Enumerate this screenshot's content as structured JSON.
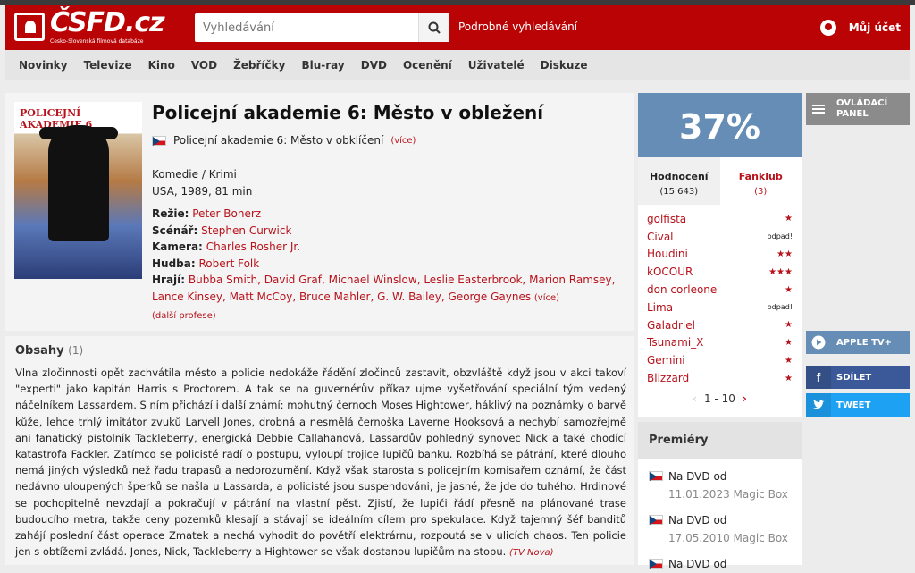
{
  "header": {
    "logo_text": "ČSFD.cz",
    "logo_sub": "Česko-Slovenská filmová databáze",
    "search_placeholder": "Vyhledávání",
    "advanced_search": "Podrobné vyhledávání",
    "account": "Můj účet"
  },
  "nav": [
    "Novinky",
    "Televize",
    "Kino",
    "VOD",
    "Žebříčky",
    "Blu-ray",
    "DVD",
    "Ocenění",
    "Uživatelé",
    "Diskuze"
  ],
  "film": {
    "poster_title": "POLICEJNÍ AKADEMIE 6",
    "title": "Policejní akademie 6: Město v obležení",
    "alt_title": "Policejní akademie 6: Město v obklíčení",
    "alt_more": "(více)",
    "genres": "Komedie / Krimi",
    "origin": "USA, 1989, 81 min",
    "director_label": "Režie:",
    "director": "Peter Bonerz",
    "writer_label": "Scénář:",
    "writer": "Stephen Curwick",
    "camera_label": "Kamera:",
    "camera": "Charles Rosher Jr.",
    "music_label": "Hudba:",
    "music": "Robert Folk",
    "cast_label": "Hrají:",
    "cast": "Bubba Smith, David Graf, Michael Winslow, Leslie Easterbrook, Marion Ramsey, Lance Kinsey, Matt McCoy, Bruce Mahler, G. W. Bailey, George Gaynes",
    "cast_more": "(více)",
    "more_professions": "(další profese)"
  },
  "plot": {
    "heading": "Obsahy",
    "count": "(1)",
    "text": "Vlna zločinnosti opět zachvátila město a policie nedokáže řádění zločinců zastavit, obzvláště když jsou v akci takoví \"experti\" jako kapitán Harris s Proctorem. A tak se na guvernérův příkaz ujme vyšetřování speciální tým vedený náčelníkem Lassardem. S ním přichází i další známí: mohutný černoch Moses Hightower, háklivý na poznámky o barvě kůže, lehce trhlý imitátor zvuků Larvell Jones, drobná a nesmělá černoška Laverne Hooksová a nechybí samozřejmě ani fanatický pistolník Tackleberry, energická Debbie Callahanová, Lassardův pohledný synovec Nick a také chodící katastrofa Fackler. Zatímco se policisté radí o postupu, vyloupí trojice lupičů banku. Rozbíhá se pátrání, které dlouho nemá jiných výsledků než řadu trapasů a nedorozumění. Když však starosta s policejním komisařem oznámí, že část nedávno uloupených šperků se našla u Lassarda, a policisté jsou suspendováni, je jasné, že jde do tuhého. Hrdinové se pochopitelně nevzdají a pokračují v pátrání na vlastní pěst. Zjistí, že lupiči řádí přesně na plánované trase budoucího metra, takže ceny pozemků klesají a stávají se ideálním cílem pro spekulace. Když tajemný šéf banditů zahájí poslední část operace Zmatek a nechá vyhodit do povětří elektrárnu, rozpoutá se v ulicích chaos. Ten policie jen s obtížemi zvládá. Jones, Nick, Tackleberry a Hightower se však dostanou lupičům na stopu.",
    "source": "(TV Nova)"
  },
  "rating": {
    "percent": "37%",
    "tab_ratings": "Hodnocení",
    "tab_ratings_count": "(15 643)",
    "tab_fanclub": "Fanklub",
    "tab_fanclub_count": "(3)",
    "users": [
      {
        "name": "golfista",
        "stars": "★"
      },
      {
        "name": "Cival",
        "stars": "odpad!"
      },
      {
        "name": "Houdini",
        "stars": "★★"
      },
      {
        "name": "kOCOUR",
        "stars": "★★★"
      },
      {
        "name": "don corleone",
        "stars": "★"
      },
      {
        "name": "Lima",
        "stars": "odpad!"
      },
      {
        "name": "Galadriel",
        "stars": "★"
      },
      {
        "name": "Tsunami_X",
        "stars": "★"
      },
      {
        "name": "Gemini",
        "stars": "★"
      },
      {
        "name": "Blizzard",
        "stars": "★"
      }
    ],
    "pager": "1 - 10"
  },
  "premieres": {
    "heading": "Premiéry",
    "items": [
      {
        "label": "Na DVD od",
        "date": "11.01.2023 Magic Box"
      },
      {
        "label": "Na DVD od",
        "date": "17.05.2010 Magic Box"
      },
      {
        "label": "Na DVD od",
        "date": ""
      }
    ]
  },
  "side": {
    "control_panel": "OVLÁDACÍ PANEL",
    "apple": "APPLE TV+",
    "share": "SDÍLET",
    "tweet": "TWEET"
  },
  "colors": {
    "brand": "#ba0305",
    "link": "#b8121b",
    "rating": "#658db5"
  }
}
